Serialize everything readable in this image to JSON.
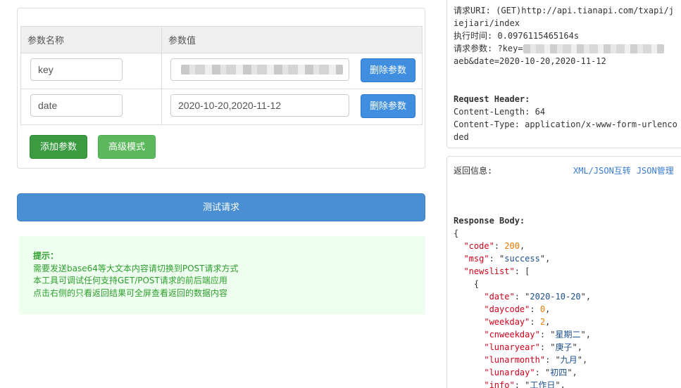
{
  "params": {
    "header_name": "参数名称",
    "header_value": "参数值",
    "rows": [
      {
        "name": "key",
        "value": "",
        "value_masked": true,
        "delete_label": "删除参数"
      },
      {
        "name": "date",
        "value": "2020-10-20,2020-11-12",
        "value_masked": false,
        "delete_label": "删除参数"
      }
    ],
    "add_label": "添加参数",
    "advanced_label": "高级模式"
  },
  "test_button": "测试请求",
  "tips": {
    "title": "提示：",
    "lines": [
      "需要发送base64等大文本内容请切换到POST请求方式",
      "本工具可调试任何支持GET/POST请求的前后端应用",
      "点击右侧的只看返回结果可全屏查看返回的数据内容"
    ]
  },
  "request_info": {
    "url_line1": "请求URI: (GET)http://api.tianapi.com/txapi/j",
    "url_line2": "iejiari/index",
    "exec_time": "执行时间: 0.0976115465164s",
    "params_prefix": "请求参数: ?key=",
    "params_line2": "aeb&date=2020-10-20,2020-11-12",
    "header_title": "Request Header:",
    "content_length": "Content-Length: 64",
    "content_type_1": "Content-Type: application/x-www-form-urlenco",
    "content_type_2": "ded"
  },
  "response": {
    "label": "返回信息:",
    "link_xml_json": "XML/JSON互转",
    "link_json_manage": "JSON管理",
    "body_title": "Response Body:",
    "json": {
      "code": 200,
      "msg": "success",
      "newslist_first": {
        "date": "2020-10-20",
        "daycode": 0,
        "weekday": 2,
        "cnweekday": "星期二",
        "lunaryear": "庚子",
        "lunarmonth": "九月",
        "lunarday": "初四",
        "info": "工作日"
      }
    }
  },
  "colors": {
    "primary_blue": "#3f8ee0",
    "dark_green": "#3a9b40",
    "light_green": "#5cb85c",
    "test_blue": "#4a8fd1",
    "tips_bg": "#efffef",
    "tips_text": "#2e9e2e",
    "json_key": "#d0021b",
    "json_string": "#1d4f91",
    "json_number": "#ea7a00"
  }
}
